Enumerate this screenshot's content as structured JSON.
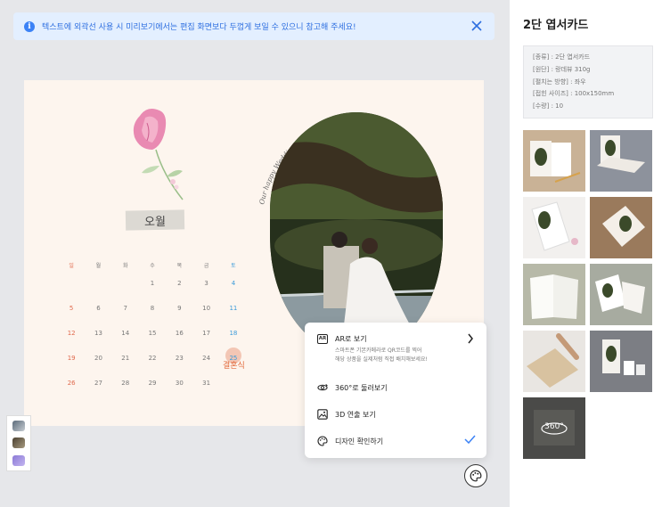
{
  "banner": {
    "message": "텍스트에 외곽선 사용 시 미리보기에서는 편집 화면보다 두껍게 보일 수 있으니 참고해 주세요!",
    "info_icon": "info-icon",
    "close_icon": "close-icon"
  },
  "card": {
    "month": "오월",
    "curve_text": "Our happy Wedding Day",
    "weekdays": [
      "일",
      "월",
      "화",
      "수",
      "목",
      "금",
      "토"
    ],
    "weeks": [
      [
        "",
        "",
        "",
        "1",
        "2",
        "3",
        "4"
      ],
      [
        "5",
        "6",
        "7",
        "8",
        "9",
        "10",
        "11"
      ],
      [
        "12",
        "13",
        "14",
        "15",
        "16",
        "17",
        "18"
      ],
      [
        "19",
        "20",
        "21",
        "22",
        "23",
        "24",
        "25"
      ],
      [
        "26",
        "27",
        "28",
        "29",
        "30",
        "31",
        ""
      ]
    ],
    "highlight_day": "25",
    "wedding_label": "결혼식"
  },
  "menu": {
    "ar_label": "AR로 보기",
    "ar_icon_text": "AR",
    "ar_desc_line1": "스마트폰 기본카메라로 QR코드를 찍어",
    "ar_desc_line2": "해당 상품을 실제처럼 직접 배치해보세요!",
    "view360_label": "360°로 둘러보기",
    "view3d_label": "3D 연출 보기",
    "design_label": "디자인 확인하기"
  },
  "panel": {
    "title": "2단 엽서카드",
    "specs": [
      "[종류] : 2단 엽서카드",
      "[원단] : 랑데뷰 310g",
      "[펼치는 방향] : 좌우",
      "[접힌 사이즈] : 100x150mm",
      "[수량] : 10"
    ],
    "badge_360": "360°"
  },
  "colors": {
    "banner_bg": "#e3efff",
    "banner_text": "#2e6fe0",
    "accent_check": "#3b82f6",
    "sunday": "#e06a4d",
    "saturday": "#3a9ad9"
  }
}
